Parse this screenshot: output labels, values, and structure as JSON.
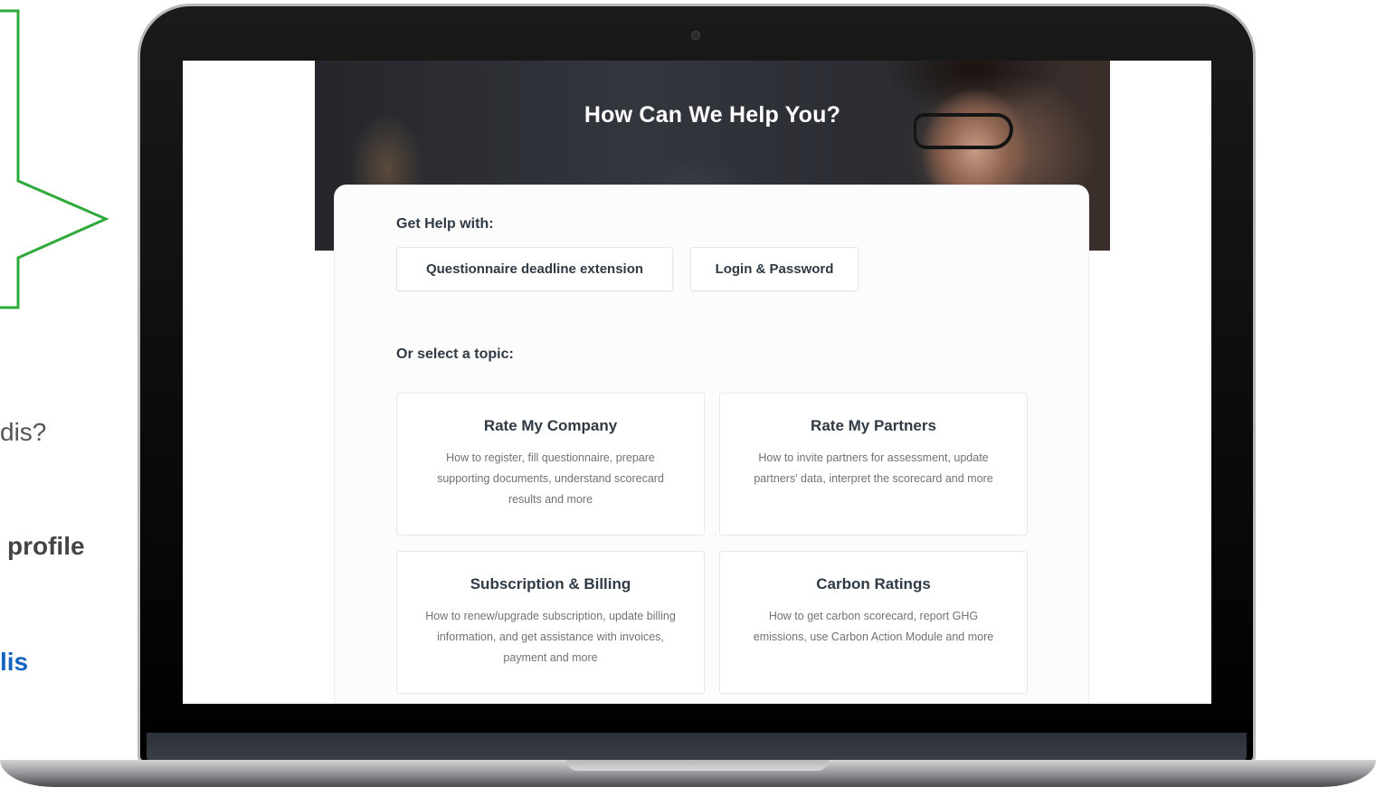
{
  "slide_fragments": {
    "line1": "dis?",
    "line2": "profile",
    "line3": "lis"
  },
  "colors": {
    "callout_green": "#2eaa3a",
    "link_blue": "#1565c0",
    "text_dark": "#2f3a45"
  },
  "hero": {
    "title": "How Can We Help You?"
  },
  "get_help": {
    "label": "Get Help with:",
    "buttons": [
      {
        "label": "Questionnaire deadline extension"
      },
      {
        "label": "Login & Password"
      }
    ]
  },
  "topics": {
    "label": "Or select a topic:",
    "items": [
      {
        "title": "Rate My Company",
        "description": "How to register, fill questionnaire, prepare supporting documents, understand scorecard results and more"
      },
      {
        "title": "Rate My Partners",
        "description": "How to invite partners for assessment, update partners' data, interpret the scorecard and more"
      },
      {
        "title": "Subscription & Billing",
        "description": "How to renew/upgrade subscription, update billing information, and get assistance with invoices, payment and more"
      },
      {
        "title": "Carbon Ratings",
        "description": "How to get carbon scorecard, report GHG emissions, use Carbon Action Module and more"
      }
    ]
  }
}
